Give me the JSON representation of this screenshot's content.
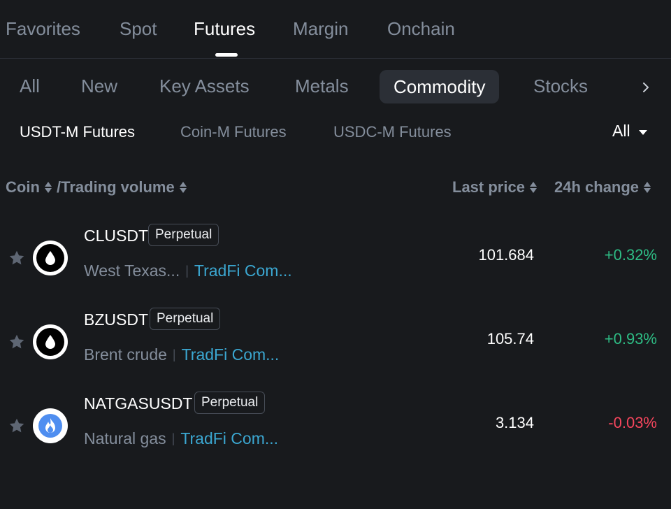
{
  "top_tabs": [
    "Favorites",
    "Spot",
    "Futures",
    "Margin",
    "Onchain"
  ],
  "categories": [
    "All",
    "New",
    "Key Assets",
    "Metals",
    "Commodity",
    "Stocks"
  ],
  "sub_tabs": [
    "USDT-M Futures",
    "Coin-M Futures",
    "USDC-M Futures"
  ],
  "filter": {
    "label": "All"
  },
  "columns": {
    "coin": "Coin",
    "volume": "/Trading volume",
    "last_price": "Last price",
    "change": "24h change"
  },
  "rows": [
    {
      "symbol": "CLUSDT",
      "badge": "Perpetual",
      "name": "West Texas...",
      "tag": "TradFi Com...",
      "price": "101.684",
      "change": "+0.32%",
      "direction": "up",
      "icon": "oil-drop-icon"
    },
    {
      "symbol": "BZUSDT",
      "badge": "Perpetual",
      "name": "Brent crude",
      "tag": "TradFi Com...",
      "price": "105.74",
      "change": "+0.93%",
      "direction": "up",
      "icon": "oil-drop-icon"
    },
    {
      "symbol": "NATGASUSDT",
      "badge": "Perpetual",
      "name": "Natural gas",
      "tag": "TradFi Com...",
      "price": "3.134",
      "change": "-0.03%",
      "direction": "down",
      "icon": "flame-icon"
    }
  ],
  "colors": {
    "positive": "#2ebd85",
    "negative": "#f6465d",
    "link": "#3ba7d1",
    "background": "#181a1d"
  }
}
